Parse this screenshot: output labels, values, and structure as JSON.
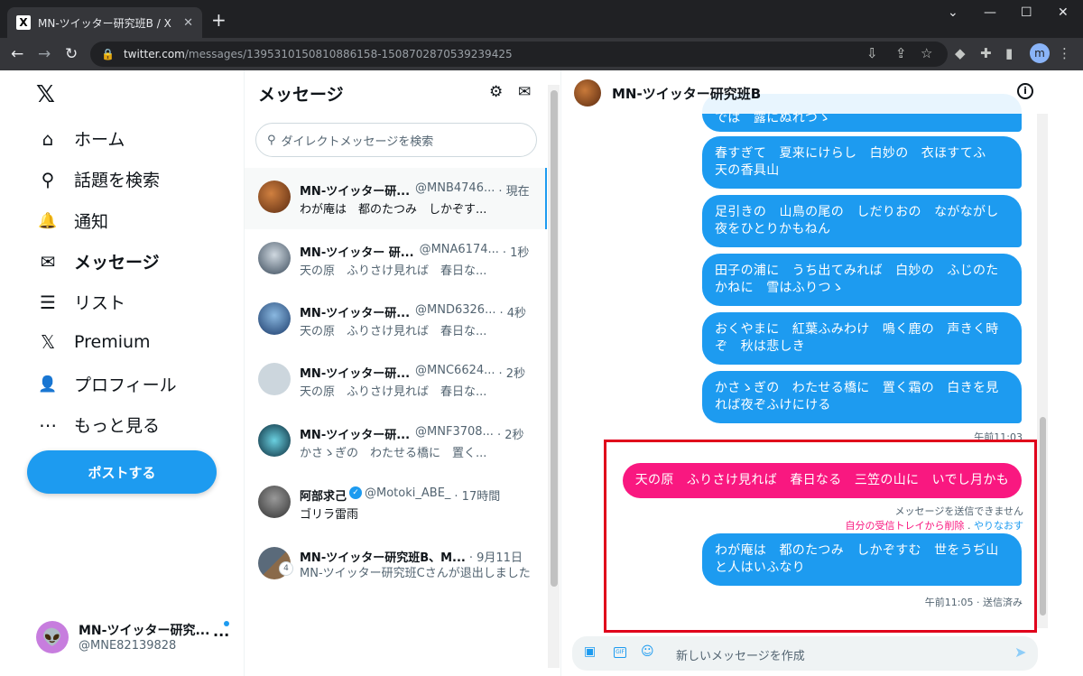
{
  "browser": {
    "tab_title": "MN-ツイッター研究班B / X",
    "tab_icon": "x-logo-icon",
    "new_tab": "+",
    "url_host": "twitter.com",
    "url_path": "/messages/1395310150810886158-1508702870539239425",
    "profile_initial": "m",
    "window_controls": [
      "⌄",
      "—",
      "☐",
      "✕"
    ]
  },
  "sidebar": {
    "logo": "𝕏",
    "items": [
      {
        "label": "ホーム",
        "icon": "home-icon",
        "glyph": "⌂"
      },
      {
        "label": "話題を検索",
        "icon": "search-icon",
        "glyph": "⚲"
      },
      {
        "label": "通知",
        "icon": "bell-icon",
        "glyph": "🔔"
      },
      {
        "label": "メッセージ",
        "icon": "envelope-icon",
        "glyph": "✉",
        "active": true
      },
      {
        "label": "リスト",
        "icon": "list-icon",
        "glyph": "☰"
      },
      {
        "label": "Premium",
        "icon": "x-icon",
        "glyph": "𝕏"
      },
      {
        "label": "プロフィール",
        "icon": "person-icon",
        "glyph": "👤"
      },
      {
        "label": "もっと見る",
        "icon": "more-circle-icon",
        "glyph": "⋯"
      }
    ],
    "post_button": "ポストする",
    "account": {
      "name": "MN-ツイッター研究...",
      "handle": "@MNE82139828",
      "more": "···"
    }
  },
  "message_list": {
    "title": "メッセージ",
    "search_placeholder": "ダイレクトメッセージを検索",
    "conversations": [
      {
        "name": "MN-ツイッター研...",
        "handle": "@MNB4746...",
        "time": "· 現在",
        "preview": "わが庵は　都のたつみ　しかぞす...",
        "selected": true,
        "color": "#8a4a20"
      },
      {
        "name": "MN-ツイッター 研...",
        "handle": "@MNA6174...",
        "time": "· 1秒",
        "preview": "天の原　ふりさけ見れば　春日な...",
        "color": "#7a8a9a"
      },
      {
        "name": "MN-ツイッター研...",
        "handle": "@MND6326...",
        "time": "· 4秒",
        "preview": "天の原　ふりさけ見れば　春日な...",
        "color": "#4a7aa8"
      },
      {
        "name": "MN-ツイッター研...",
        "handle": "@MNC6624...",
        "time": "· 2秒",
        "preview": "天の原　ふりさけ見れば　春日な...",
        "color": "#ccd6dd"
      },
      {
        "name": "MN-ツイッター研...",
        "handle": "@MNF3708...",
        "time": "· 2秒",
        "preview": "かさゝぎの　わたせる橋に　置く...",
        "color": "#1e5a6a"
      },
      {
        "name": "阿部求己",
        "handle": "@Motoki_ABE_",
        "time": "· 17時間",
        "preview": "ゴリラ雷雨",
        "verified": true,
        "color": "#555555"
      },
      {
        "name": "MN-ツイッター研究班B、M...",
        "handle": "",
        "time": "· 9月11日",
        "preview": "MN-ツイッター研究班Cさんが退出しました",
        "color": "#6a5a4a",
        "badge": "4"
      }
    ]
  },
  "chat": {
    "title": "MN-ツイッター研究班B",
    "messages": [
      {
        "text": "では　露にぬれつゝ"
      },
      {
        "text": "春すぎて　夏来にけらし　白妙の　衣ほすてふ　天の香具山"
      },
      {
        "text": "足引きの　山鳥の尾の　しだりおの　ながながし夜をひとりかもねん"
      },
      {
        "text": "田子の浦に　うち出てみれば　白妙の　ふじのたかねに　雪はふりつゝ"
      },
      {
        "text": "おくやまに　紅葉ふみわけ　鳴く鹿の　声きく時ぞ　秋は悲しき"
      },
      {
        "text": "かさゝぎの　わたせる橋に　置く霜の　白きを見れば夜ぞふけにける"
      }
    ],
    "time1": "午前11:03",
    "failed_message": "天の原　ふりさけ見れば　春日なる　三笠の山に　いでし月かも",
    "failed_note": "メッセージを送信できません",
    "delete_link": "自分の受信トレイから削除",
    "separator": " . ",
    "retry_link": "やりなおす",
    "last_message": "わが庵は　都のたつみ　しかぞすむ　世をうぢ山と人はいふなり",
    "last_meta": "午前11:05 · 送信済み",
    "composer_placeholder": "新しいメッセージを作成",
    "colors": {
      "accent": "#1d9bf0",
      "failed": "#f91880",
      "highlight": "#e0001b"
    }
  }
}
